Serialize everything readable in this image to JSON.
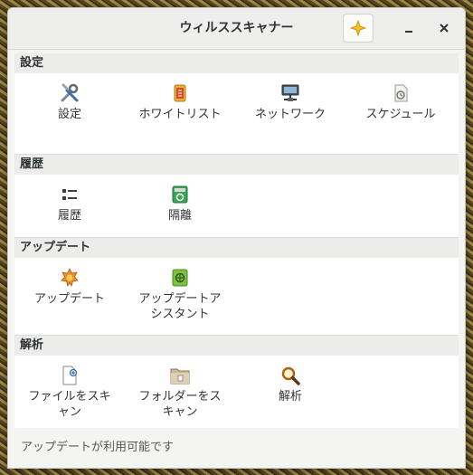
{
  "window": {
    "title": "ウィルススキャナー",
    "buttons": {
      "spark_icon": "sparkle-icon",
      "minimize_icon": "minimize-icon",
      "close_icon": "close-icon"
    }
  },
  "sections": [
    {
      "title": "設定",
      "items": [
        {
          "label": "設定",
          "icon": "tools-icon"
        },
        {
          "label": "ホワイトリスト",
          "icon": "whitelist-icon"
        },
        {
          "label": "ネットワーク",
          "icon": "network-icon"
        },
        {
          "label": "スケジュール",
          "icon": "schedule-icon"
        }
      ]
    },
    {
      "title": "履歴",
      "items": [
        {
          "label": "履歴",
          "icon": "history-list-icon"
        },
        {
          "label": "隔離",
          "icon": "quarantine-icon"
        }
      ]
    },
    {
      "title": "アップデート",
      "items": [
        {
          "label": "アップデート",
          "icon": "update-icon"
        },
        {
          "label": "アップデートアシスタント",
          "icon": "update-assistant-icon"
        }
      ]
    },
    {
      "title": "解析",
      "items": [
        {
          "label": "ファイルをスキャン",
          "icon": "scan-file-icon"
        },
        {
          "label": "フォルダーをスキャン",
          "icon": "scan-folder-icon"
        },
        {
          "label": "解析",
          "icon": "analysis-magnifier-icon"
        }
      ]
    }
  ],
  "status": {
    "text": "アップデートが利用可能です"
  },
  "colors": {
    "accent": "#f5a623",
    "window_bg": "#f4f4f3",
    "section_bg": "#ffffff"
  }
}
